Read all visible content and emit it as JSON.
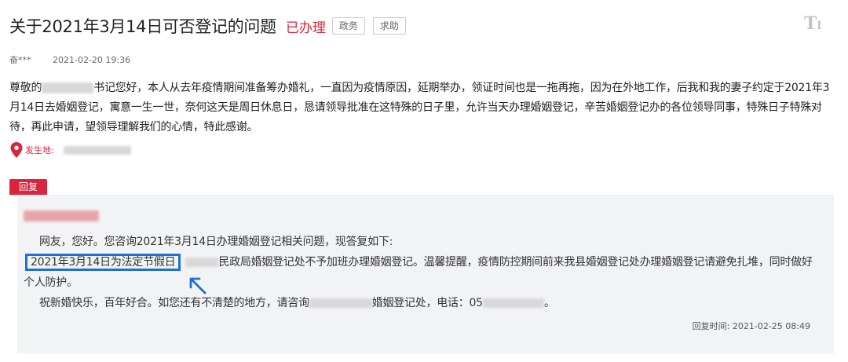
{
  "title": "关于2021年3月14日可否登记的问题",
  "status": "已办理",
  "tags": [
    "政务",
    "求助"
  ],
  "font_size_icon": "font-size-icon",
  "author": "奋***",
  "post_date": "2021-02-20 19:36",
  "body": {
    "greeting_prefix": "尊敬的",
    "text": "书记您好，本人从去年疫情期间准备筹办婚礼，一直因为疫情原因，延期举办，领证时间也是一拖再拖，因为在外地工作，后我和我的妻子约定于2021年3月14日去婚姻登记，寓意一生一世，奈何这天是周日休息日，恳请领导批准在这特殊的日子里，允许当天办理婚姻登记，辛苦婚姻登记办的各位领导同事，特殊日子特殊对待，再此申请，望领导理解我们的心情，特此感谢。"
  },
  "location_label": "发生地:",
  "location_icon": "map-pin-icon",
  "reply_tab": "回复",
  "reply": {
    "line1": "网友，您好。您咨询2021年3月14日办理婚姻登记相关问题，现答复如下:",
    "highlight": "2021年3月14日为法定节假日",
    "line2_suffix": "民政局婚姻登记处不予加班办理婚姻登记。温馨提醒，疫情防控期间前来我县婚姻登记处办理婚姻登记请避免扎堆，同时做好个人防护。",
    "line3_prefix": "祝新婚快乐，百年好合。如您还有不清楚的地方，请咨询",
    "line3_mid": "婚姻登记处，电话：05",
    "line3_end": "。",
    "time_label": "回复时间:",
    "time": "2021-02-25 08:49"
  },
  "colors": {
    "accent_red": "#d7263d",
    "highlight_blue": "#1e6fd9",
    "reply_bg": "#f2f3f5"
  }
}
